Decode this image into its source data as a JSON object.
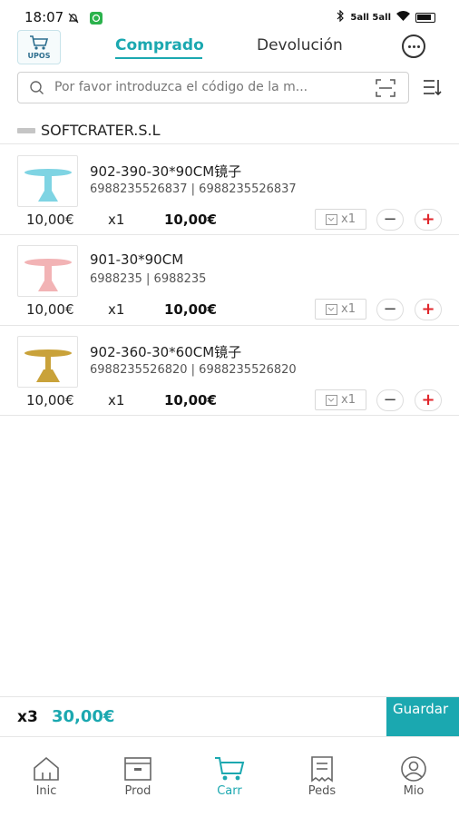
{
  "status_bar": {
    "time": "18:07",
    "signal": "5all 5all",
    "battery": "85"
  },
  "header": {
    "logo_text": "UPOS",
    "tabs": [
      {
        "label": "Comprado",
        "active": true
      },
      {
        "label": "Devolución",
        "active": false
      }
    ]
  },
  "search": {
    "placeholder": "Por favor introduzca el código de la m..."
  },
  "store": {
    "name": "SOFTCRATER.S.L"
  },
  "items": [
    {
      "name": "902-390-30*90CM镜子",
      "codes": "6988235526837 | 6988235526837",
      "price": "10,00€",
      "qty": "x1",
      "total": "10,00€",
      "note_qty": "x1",
      "image_color": "#7fd4e3"
    },
    {
      "name": "901-30*90CM",
      "codes": "6988235 | 6988235",
      "price": "10,00€",
      "qty": "x1",
      "total": "10,00€",
      "note_qty": "x1",
      "image_color": "#f2b3b5"
    },
    {
      "name": "902-360-30*60CM镜子",
      "codes": "6988235526820 | 6988235526820",
      "price": "10,00€",
      "qty": "x1",
      "total": "10,00€",
      "note_qty": "x1",
      "image_color": "#c9a23a"
    }
  ],
  "footer": {
    "count": "x3",
    "total": "30,00€",
    "save_label": "Guardar"
  },
  "bottom_nav": [
    {
      "label": "Inic",
      "icon": "home-icon",
      "active": false
    },
    {
      "label": "Prod",
      "icon": "box-icon",
      "active": false
    },
    {
      "label": "Carr",
      "icon": "cart-icon",
      "active": true
    },
    {
      "label": "Peds",
      "icon": "orders-icon",
      "active": false
    },
    {
      "label": "Mio",
      "icon": "user-icon",
      "active": false
    }
  ],
  "colors": {
    "accent": "#1ba8b0",
    "plus_red": "#e0262b",
    "text": "#222222"
  }
}
